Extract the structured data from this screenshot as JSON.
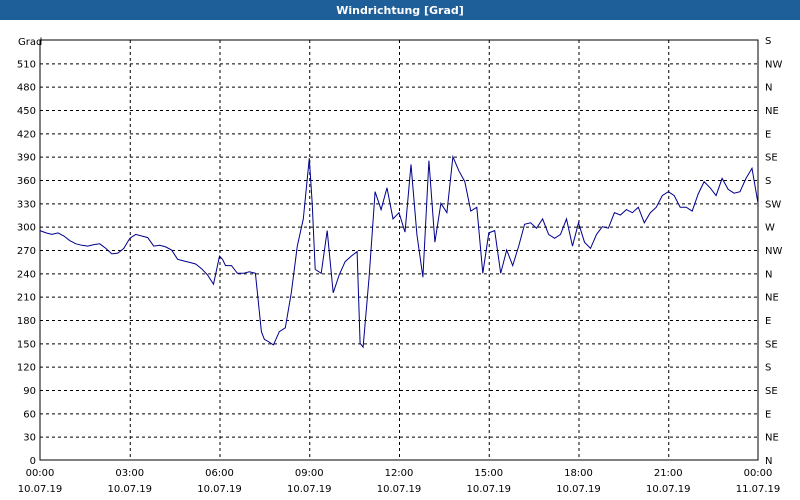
{
  "window": {
    "title": "Windrichtung [Grad]"
  },
  "chart_data": {
    "type": "line",
    "title": "Windrichtung [Grad]",
    "ylabel": "Grad",
    "ylim": [
      0,
      540
    ],
    "yticks": [
      0,
      30,
      60,
      90,
      120,
      150,
      180,
      210,
      240,
      270,
      300,
      330,
      360,
      390,
      420,
      450,
      480,
      510
    ],
    "xlim": [
      0,
      24
    ],
    "xticks": [
      {
        "time": "00:00",
        "date": "10.07.19",
        "h": 0
      },
      {
        "time": "03:00",
        "date": "10.07.19",
        "h": 3
      },
      {
        "time": "06:00",
        "date": "10.07.19",
        "h": 6
      },
      {
        "time": "09:00",
        "date": "10.07.19",
        "h": 9
      },
      {
        "time": "12:00",
        "date": "10.07.19",
        "h": 12
      },
      {
        "time": "15:00",
        "date": "10.07.19",
        "h": 15
      },
      {
        "time": "18:00",
        "date": "10.07.19",
        "h": 18
      },
      {
        "time": "21:00",
        "date": "10.07.19",
        "h": 21
      },
      {
        "time": "00:00",
        "date": "11.07.19",
        "h": 24
      }
    ],
    "y2ticks": [
      {
        "label": "N",
        "v": 0
      },
      {
        "label": "NE",
        "v": 30
      },
      {
        "label": "E",
        "v": 60
      },
      {
        "label": "SE",
        "v": 90
      },
      {
        "label": "S",
        "v": 120
      },
      {
        "label": "SE",
        "v": 150
      },
      {
        "label": "E",
        "v": 180
      },
      {
        "label": "NE",
        "v": 210
      },
      {
        "label": "N",
        "v": 240
      },
      {
        "label": "NW",
        "v": 270
      },
      {
        "label": "W",
        "v": 300
      },
      {
        "label": "SW",
        "v": 330
      },
      {
        "label": "S",
        "v": 360
      },
      {
        "label": "SE",
        "v": 390
      },
      {
        "label": "E",
        "v": 420
      },
      {
        "label": "NE",
        "v": 450
      },
      {
        "label": "N",
        "v": 480
      },
      {
        "label": "NW",
        "v": 510
      },
      {
        "label": "S",
        "v": 540
      }
    ],
    "grid": true,
    "colors": {
      "line": "#00008b",
      "grid": "#000000",
      "title_bar": "#1f5f99"
    },
    "series": [
      {
        "x": [
          0,
          0.2,
          0.4,
          0.6,
          0.8,
          1.0,
          1.2,
          1.4,
          1.6,
          1.8,
          2.0,
          2.2,
          2.4,
          2.6,
          2.8,
          3.0,
          3.2,
          3.4,
          3.6,
          3.8,
          4.0,
          4.2,
          4.4,
          4.6,
          4.8,
          5.0,
          5.2,
          5.4,
          5.6,
          5.8,
          6.0,
          6.1,
          6.2,
          6.3,
          6.4,
          6.6,
          6.8,
          7.0,
          7.2,
          7.4,
          7.5,
          7.6,
          7.8,
          8.0,
          8.2,
          8.4,
          8.6,
          8.8,
          9.0,
          9.1,
          9.2,
          9.4,
          9.6,
          9.8,
          10.0,
          10.2,
          10.4,
          10.6,
          10.7,
          10.8,
          11.0,
          11.2,
          11.4,
          11.6,
          11.8,
          12.0,
          12.2,
          12.4,
          12.6,
          12.8,
          13.0,
          13.2,
          13.4,
          13.6,
          13.8,
          14.0,
          14.2,
          14.4,
          14.6,
          14.8,
          15.0,
          15.2,
          15.4,
          15.6,
          15.8,
          16.0,
          16.2,
          16.4,
          16.6,
          16.8,
          17.0,
          17.2,
          17.4,
          17.6,
          17.8,
          18.0,
          18.2,
          18.4,
          18.6,
          18.8,
          19.0,
          19.2,
          19.4,
          19.6,
          19.8,
          20.0,
          20.2,
          20.4,
          20.6,
          20.8,
          21.0,
          21.2,
          21.4,
          21.6,
          21.8,
          22.0,
          22.2,
          22.4,
          22.6,
          22.8,
          23.0,
          23.2,
          23.4,
          23.6,
          23.8,
          24.0
        ],
        "values": [
          295,
          292,
          290,
          292,
          288,
          282,
          278,
          276,
          275,
          277,
          278,
          272,
          265,
          266,
          272,
          285,
          290,
          288,
          286,
          275,
          276,
          274,
          270,
          258,
          256,
          254,
          252,
          246,
          238,
          226,
          262,
          258,
          250,
          250,
          250,
          240,
          240,
          242,
          240,
          165,
          155,
          153,
          148,
          165,
          170,
          215,
          275,
          310,
          388,
          330,
          245,
          240,
          295,
          215,
          238,
          255,
          262,
          268,
          150,
          145,
          235,
          345,
          322,
          350,
          310,
          318,
          293,
          380,
          290,
          235,
          385,
          280,
          330,
          318,
          390,
          372,
          358,
          320,
          325,
          240,
          292,
          295,
          240,
          270,
          250,
          275,
          303,
          305,
          298,
          310,
          290,
          285,
          290,
          310,
          275,
          305,
          280,
          272,
          290,
          300,
          298,
          318,
          315,
          322,
          318,
          325,
          305,
          318,
          325,
          340,
          345,
          340,
          325,
          325,
          320,
          342,
          358,
          350,
          340,
          362,
          348,
          343,
          345,
          362,
          375,
          330
        ]
      }
    ]
  }
}
